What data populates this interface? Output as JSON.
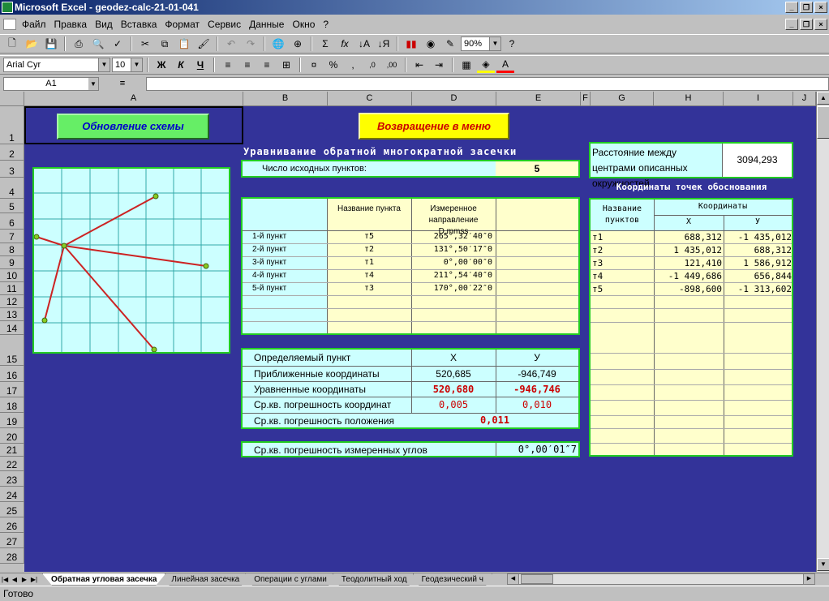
{
  "window": {
    "title": "Microsoft Excel - geodez-calc-21-01-041"
  },
  "menu": [
    "Файл",
    "Правка",
    "Вид",
    "Вставка",
    "Формат",
    "Сервис",
    "Данные",
    "Окно",
    "?"
  ],
  "toolbar": {
    "zoom": "90%",
    "font": "Arial Cyr",
    "size": "10"
  },
  "formula": {
    "cell_ref": "A1",
    "eq": "=",
    "value": ""
  },
  "columns": [
    "A",
    "B",
    "C",
    "D",
    "E",
    "F",
    "G",
    "H",
    "I",
    "J"
  ],
  "rows": [
    "1",
    "2",
    "3",
    "4",
    "5",
    "6",
    "7",
    "8",
    "9",
    "10",
    "11",
    "12",
    "13",
    "14",
    "15",
    "16",
    "17",
    "18",
    "19",
    "20",
    "21",
    "22",
    "23",
    "24",
    "25",
    "26",
    "27",
    "28"
  ],
  "buttons": {
    "refresh": "Обновление схемы",
    "back": "Возвращение в меню"
  },
  "title": "Уравнивание обратной многократной засечки",
  "source_count": {
    "label": "Число исходных пунктов:",
    "value": "5"
  },
  "obs_table": {
    "headers": {
      "name": "Название пункта",
      "dir": "Измеренное направление D.mmss"
    },
    "rows": [
      {
        "label": "1-й пункт",
        "name": "т5",
        "dir": "265°,32′40″0"
      },
      {
        "label": "2-й пункт",
        "name": "т2",
        "dir": "131°,50′17″0"
      },
      {
        "label": "3-й пункт",
        "name": "т1",
        "dir": "0°,00′00″0"
      },
      {
        "label": "4-й пункт",
        "name": "т4",
        "dir": "211°,54′40″0"
      },
      {
        "label": "5-й пункт",
        "name": "т3",
        "dir": "170°,00′22″0"
      }
    ]
  },
  "result_table": {
    "header": {
      "label": "Определяемый пункт",
      "x": "X",
      "y": "У"
    },
    "approx": {
      "label": "Приближенные координаты",
      "x": "520,685",
      "y": "-946,749"
    },
    "adjusted": {
      "label": "Уравненные координаты",
      "x": "520,680",
      "y": "-946,746"
    },
    "coord_err": {
      "label": "Ср.кв. погрешность координат",
      "x": "0,005",
      "y": "0,010"
    },
    "pos_err": {
      "label": "Ср.кв. погрешность положения",
      "value": "0,011"
    }
  },
  "angle_err": {
    "label": "Ср.кв. погрешность измеренных углов",
    "value": "0°,00′01″7"
  },
  "distance": {
    "label": "Расстояние между центрами описанных окружностей",
    "value": "3094,293"
  },
  "coords_table": {
    "title": "Координаты точек обоснования",
    "headers": {
      "name": "Название пунктов",
      "coords": "Координаты",
      "x": "X",
      "y": "У"
    },
    "rows": [
      {
        "name": "т1",
        "x": "688,312",
        "y": "-1 435,012"
      },
      {
        "name": "т2",
        "x": "1 435,012",
        "y": "688,312"
      },
      {
        "name": "т3",
        "x": "121,410",
        "y": "1 586,912"
      },
      {
        "name": "т4",
        "x": "-1 449,686",
        "y": "656,844"
      },
      {
        "name": "т5",
        "x": "-898,600",
        "y": "-1 313,602"
      }
    ]
  },
  "sheet_tabs": [
    "Обратная угловая засечка",
    "Линейная засечка",
    "Операции с углами",
    "Теодолитный ход",
    "Геодезический ч"
  ],
  "status": "Готово",
  "colors": {
    "sheet_bg": "#333399",
    "border": "#22cc22",
    "cyan": "#ccffff",
    "yellow": "#ffffcc",
    "red": "#cc0000"
  }
}
